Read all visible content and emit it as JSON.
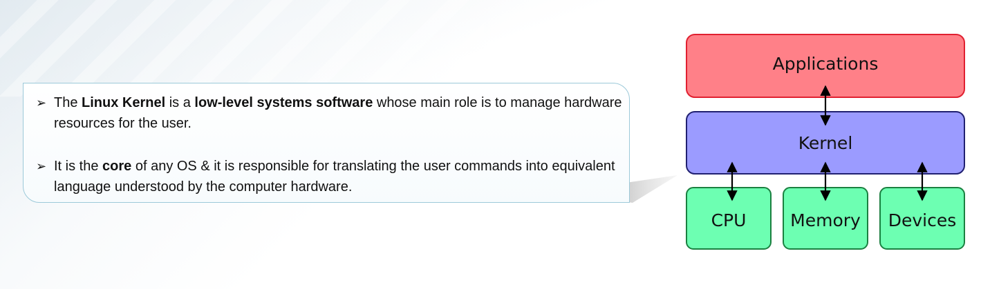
{
  "bullets": [
    {
      "parts": [
        {
          "text": "The ",
          "bold": false
        },
        {
          "text": "Linux Kernel",
          "bold": true
        },
        {
          "text": " is a ",
          "bold": false
        },
        {
          "text": "low-level systems software",
          "bold": true
        },
        {
          "text": " whose main role is to manage hardware resources for the user.",
          "bold": false
        }
      ]
    },
    {
      "parts": [
        {
          "text": "It is the ",
          "bold": false
        },
        {
          "text": "core",
          "bold": true
        },
        {
          "text": " of any OS & it is responsible for translating the user commands into equivalent language understood by the computer hardware.",
          "bold": false
        }
      ]
    }
  ],
  "bullet_icon": "arrowhead-bullet-icon",
  "diagram": {
    "applications": {
      "label": "Applications",
      "fill": "#ff8088",
      "stroke": "#e02030"
    },
    "kernel": {
      "label": "Kernel",
      "fill": "#9b9bff",
      "stroke": "#202070"
    },
    "hardware": [
      {
        "label": "CPU"
      },
      {
        "label": "Memory"
      },
      {
        "label": "Devices"
      }
    ],
    "hardware_fill": "#6dffb2",
    "hardware_stroke": "#1a8040",
    "connector_color": "#000000"
  }
}
